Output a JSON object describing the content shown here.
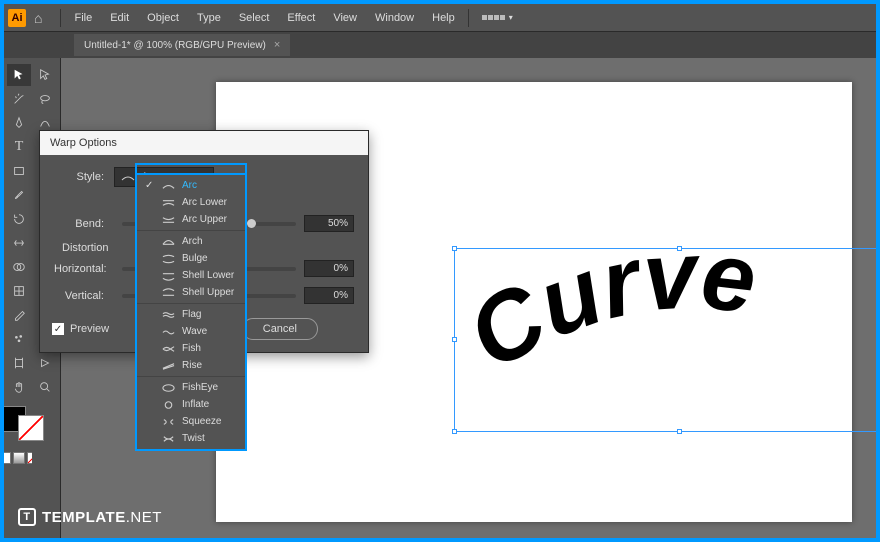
{
  "menu": {
    "items": [
      "File",
      "Edit",
      "Object",
      "Type",
      "Select",
      "Effect",
      "View",
      "Window",
      "Help"
    ]
  },
  "tab": {
    "title": "Untitled-1* @ 100% (RGB/GPU Preview)"
  },
  "canvas": {
    "text": "Curve"
  },
  "dialog": {
    "title": "Warp Options",
    "style_label": "Style:",
    "style_value": "Arc",
    "bend_label": "Bend:",
    "bend_value": "50%",
    "distortion_label": "Distortion",
    "horizontal_label": "Horizontal:",
    "horizontal_value": "0%",
    "vertical_label": "Vertical:",
    "vertical_value": "0%",
    "preview_label": "Preview",
    "cancel_label": "Cancel"
  },
  "dropdown": {
    "items": [
      "Arc",
      "Arc Lower",
      "Arc Upper",
      "Arch",
      "Bulge",
      "Shell Lower",
      "Shell Upper",
      "Flag",
      "Wave",
      "Fish",
      "Rise",
      "FishEye",
      "Inflate",
      "Squeeze",
      "Twist"
    ],
    "selected": "Arc"
  },
  "watermark": {
    "brand": "TEMPLATE",
    "suffix": ".NET"
  }
}
